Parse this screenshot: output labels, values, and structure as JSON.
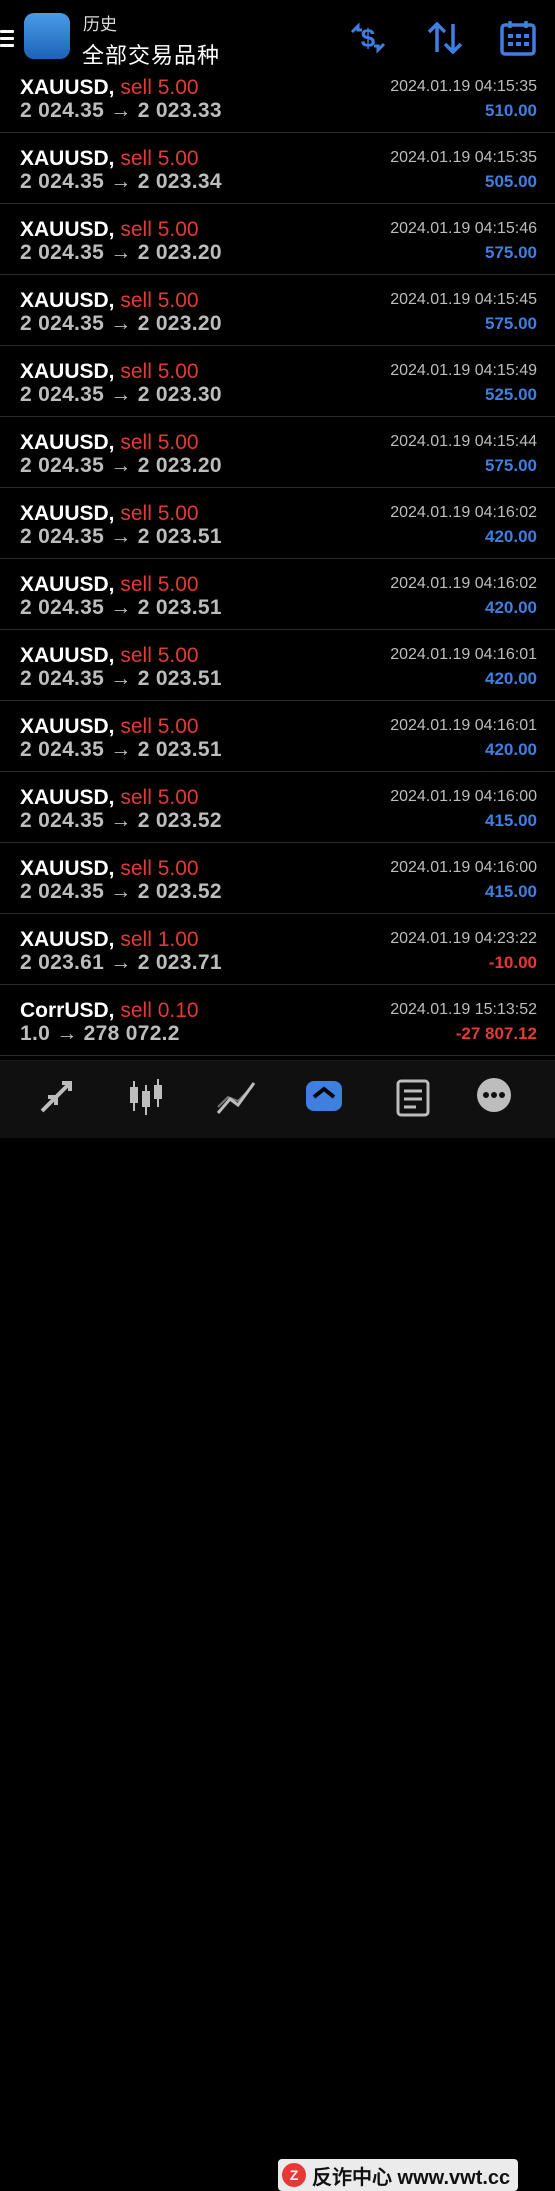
{
  "header": {
    "subtitle": "历史",
    "title": "全部交易品种"
  },
  "trades": [
    {
      "symbol": "XAUUSD,",
      "side": "sell 5.00",
      "prices": "2 024.35 → 2 023.33",
      "time": "2024.01.19 04:15:35",
      "profit": "510.00",
      "negative": false
    },
    {
      "symbol": "XAUUSD,",
      "side": "sell 5.00",
      "prices": "2 024.35 → 2 023.34",
      "time": "2024.01.19 04:15:35",
      "profit": "505.00",
      "negative": false
    },
    {
      "symbol": "XAUUSD,",
      "side": "sell 5.00",
      "prices": "2 024.35 → 2 023.20",
      "time": "2024.01.19 04:15:46",
      "profit": "575.00",
      "negative": false
    },
    {
      "symbol": "XAUUSD,",
      "side": "sell 5.00",
      "prices": "2 024.35 → 2 023.20",
      "time": "2024.01.19 04:15:45",
      "profit": "575.00",
      "negative": false
    },
    {
      "symbol": "XAUUSD,",
      "side": "sell 5.00",
      "prices": "2 024.35 → 2 023.30",
      "time": "2024.01.19 04:15:49",
      "profit": "525.00",
      "negative": false
    },
    {
      "symbol": "XAUUSD,",
      "side": "sell 5.00",
      "prices": "2 024.35 → 2 023.20",
      "time": "2024.01.19 04:15:44",
      "profit": "575.00",
      "negative": false
    },
    {
      "symbol": "XAUUSD,",
      "side": "sell 5.00",
      "prices": "2 024.35 → 2 023.51",
      "time": "2024.01.19 04:16:02",
      "profit": "420.00",
      "negative": false
    },
    {
      "symbol": "XAUUSD,",
      "side": "sell 5.00",
      "prices": "2 024.35 → 2 023.51",
      "time": "2024.01.19 04:16:02",
      "profit": "420.00",
      "negative": false
    },
    {
      "symbol": "XAUUSD,",
      "side": "sell 5.00",
      "prices": "2 024.35 → 2 023.51",
      "time": "2024.01.19 04:16:01",
      "profit": "420.00",
      "negative": false
    },
    {
      "symbol": "XAUUSD,",
      "side": "sell 5.00",
      "prices": "2 024.35 → 2 023.51",
      "time": "2024.01.19 04:16:01",
      "profit": "420.00",
      "negative": false
    },
    {
      "symbol": "XAUUSD,",
      "side": "sell 5.00",
      "prices": "2 024.35 → 2 023.52",
      "time": "2024.01.19 04:16:00",
      "profit": "415.00",
      "negative": false
    },
    {
      "symbol": "XAUUSD,",
      "side": "sell 5.00",
      "prices": "2 024.35 → 2 023.52",
      "time": "2024.01.19 04:16:00",
      "profit": "415.00",
      "negative": false
    },
    {
      "symbol": "XAUUSD,",
      "side": "sell 1.00",
      "prices": "2 023.61 → 2 023.71",
      "time": "2024.01.19 04:23:22",
      "profit": "-10.00",
      "negative": true
    },
    {
      "symbol": "CorrUSD,",
      "side": "sell 0.10",
      "prices": "1.0 → 278 072.2",
      "time": "2024.01.19 15:13:52",
      "profit": "-27 807.12",
      "negative": true
    }
  ],
  "colors": {
    "positive": "#3f7fe0",
    "negative": "#e53935",
    "accent": "#3f7fe0"
  },
  "header_icons": [
    "dollar-swap-icon",
    "sort-arrows-icon",
    "calendar-icon"
  ],
  "nav_icons": [
    "trade-arrows-icon",
    "candlestick-icon",
    "chart-line-icon",
    "history-icon",
    "news-icon",
    "chat-icon"
  ],
  "watermark": {
    "logo": "Z",
    "text": "反诈中心 www.vwt.cc"
  }
}
